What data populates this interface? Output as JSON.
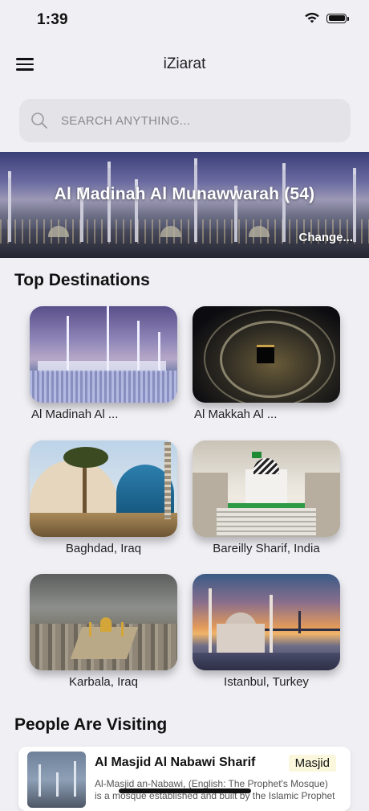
{
  "status_bar": {
    "time": "1:39"
  },
  "nav": {
    "title": "iZiarat"
  },
  "search": {
    "placeholder": "SEARCH ANYTHING..."
  },
  "banner": {
    "city_label": "Al Madinah Al Munawwarah (54)",
    "change_label": "Change..."
  },
  "top_destinations": {
    "title": "Top Destinations",
    "items": [
      {
        "label": "Al Madinah Al ..."
      },
      {
        "label": "Al Makkah Al ..."
      },
      {
        "label": "Baghdad, Iraq"
      },
      {
        "label": "Bareilly Sharif, India"
      },
      {
        "label": "Karbala, Iraq"
      },
      {
        "label": "Istanbul, Turkey"
      }
    ]
  },
  "people_visiting": {
    "title": "People Are Visiting",
    "items": [
      {
        "title": "Al Masjid Al Nabawi Sharif",
        "badge": "Masjid",
        "description": "Al-Masjid an-Nabawi, (English: The Prophet's Mosque) is a mosque established and built by the Islamic Prophet"
      }
    ]
  }
}
